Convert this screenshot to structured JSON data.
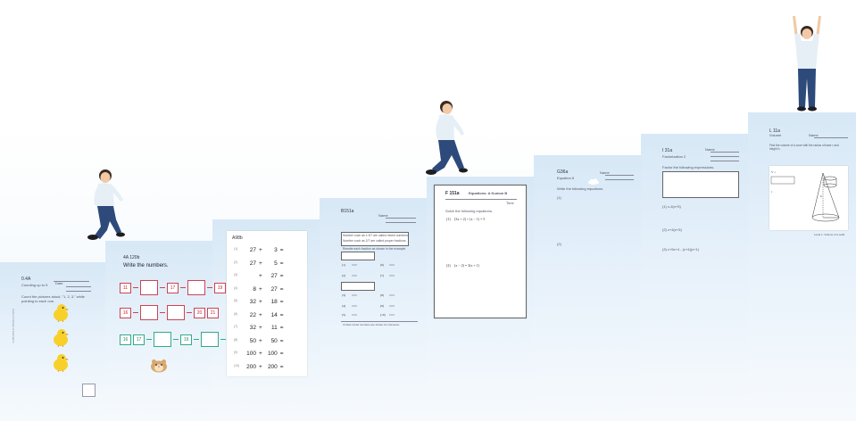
{
  "steps": [
    {
      "id": "step1"
    },
    {
      "id": "step2"
    },
    {
      "id": "step3"
    },
    {
      "id": "step4"
    },
    {
      "id": "step5"
    },
    {
      "id": "step6"
    },
    {
      "id": "step7"
    },
    {
      "id": "step8"
    }
  ],
  "sheet1": {
    "code": "0.4A",
    "name_label": "Name",
    "subtitle": "Counting up to 5",
    "date_label": "Date",
    "score_label": "Score",
    "instruction": "Count the pictures aloud, \"1, 2, 3,\" while pointing to each one."
  },
  "sheet2": {
    "code": "4A 120b",
    "title": "Write the numbers.",
    "row1": [
      "11",
      "",
      "17",
      "",
      "19",
      "20"
    ],
    "row2": [
      "16",
      "",
      "",
      "",
      "20",
      "21"
    ],
    "row3": [
      "16",
      "17",
      "",
      "19",
      "",
      "21"
    ]
  },
  "sheet3": {
    "code": "A98b",
    "rows": [
      {
        "n": "(1)",
        "a": "27",
        "op": "+",
        "b": "3",
        "eq": "="
      },
      {
        "n": "(2)",
        "a": "27",
        "op": "+",
        "b": "5",
        "eq": "="
      },
      {
        "n": "(3)",
        "a": "",
        "op": "+",
        "b": "27",
        "eq": "="
      },
      {
        "n": "(4)",
        "a": "8",
        "op": "+",
        "b": "27",
        "eq": "="
      },
      {
        "n": "(5)",
        "a": "32",
        "op": "+",
        "b": "18",
        "eq": "="
      },
      {
        "n": "(6)",
        "a": "22",
        "op": "+",
        "b": "14",
        "eq": "="
      },
      {
        "n": "(7)",
        "a": "32",
        "op": "+",
        "b": "11",
        "eq": "="
      },
      {
        "n": "(8)",
        "a": "50",
        "op": "+",
        "b": "50",
        "eq": "="
      },
      {
        "n": "(9)",
        "a": "100",
        "op": "+",
        "b": "100",
        "eq": "="
      },
      {
        "n": "(10)",
        "a": "200",
        "op": "+",
        "b": "200",
        "eq": "="
      }
    ]
  },
  "sheet4": {
    "code": "B151a",
    "name_label": "Name",
    "example1": "Number such as 4 3/7 are called mixed numbers.",
    "example2": "Number such as 2/7 are called proper fractions.",
    "instruction": "Rewrite each fraction as shown in the example.",
    "footer": "Circled mixed numbers are shown for reference."
  },
  "sheet5": {
    "code": "F 151a",
    "level": "Level F",
    "subtitle": "Equations: A Kumon B",
    "time_label": "Time",
    "instruction": "Solve the following equations."
  },
  "sheet6": {
    "code": "G36a",
    "name_label": "Name",
    "subtitle": "Equation 6",
    "instruction": "Write the following equations.",
    "item1": "(1)",
    "item2": "(2)"
  },
  "sheet7": {
    "code": "I 31a",
    "name_label": "Name",
    "subtitle": "Factorization 2",
    "instruction": "Factor the following expressions.",
    "item1": "(1) x-4(x+5)",
    "item2": "(2) x+4(x+5)",
    "item3": "(3) x+5x+4 - (x+4)(x+1)"
  },
  "sheet8": {
    "code": "L 11a",
    "name_label": "Name",
    "subtitle": "Volume",
    "instruction": "Find the volume of a cone with the radius of base r and height h.",
    "footer": "Level L: Volume of a solid"
  },
  "colors": {
    "step_top": "#d7e8f6",
    "step_bottom": "#f6fafd",
    "number_box": "#cc4455",
    "number_box_green": "#33aa88"
  },
  "icons": {
    "chick": "chick-icon",
    "hamster": "hamster-icon",
    "boy": "boy-illustration"
  }
}
